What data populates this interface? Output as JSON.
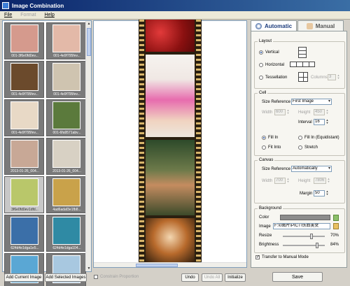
{
  "window": {
    "title": "Image Combination"
  },
  "menu": {
    "file": "File",
    "format": "Format",
    "help": "Help"
  },
  "thumbnails": [
    {
      "caption": "001-3f6e0fd0ev...",
      "color": "#d59a8d"
    },
    {
      "caption": "001-4e9f795fev...",
      "color": "#e3b9a8"
    },
    {
      "caption": "001-4e9f795fev...",
      "color": "#6b4a2c"
    },
    {
      "caption": "001-4e9f795fev...",
      "color": "#cfc4b0"
    },
    {
      "caption": "001-4e9f795fev...",
      "color": "#e8d9c6"
    },
    {
      "caption": "001-6fa9571abv...",
      "color": "#5b7a3c"
    },
    {
      "caption": "2013-01-26_004...",
      "color": "#c8a896"
    },
    {
      "caption": "2013-01-26_004...",
      "color": "#d8d1c4"
    },
    {
      "caption": "3f6e0fd0ev1dfd...",
      "color": "#b9c76a"
    },
    {
      "caption": "4ad6adaf3e1fb8...",
      "color": "#c9a24a"
    },
    {
      "caption": "624d4e1dga1e5...",
      "color": "#3b6fa8"
    },
    {
      "caption": "624d4e1dga104...",
      "color": "#2f8aa4"
    },
    {
      "caption": "",
      "color": "#5aa7d4"
    },
    {
      "caption": "",
      "color": "#a8c8e0"
    }
  ],
  "buttons": {
    "add_current": "Add Current Image",
    "add_selected": "Add Selected Images",
    "undo": "Undo",
    "undo_all": "Undo All",
    "initialize": "Initialize",
    "save": "Save"
  },
  "constrain_proportion": "Constrain Proportion",
  "tabs": {
    "automatic": "Automatic",
    "manual": "Manual"
  },
  "layout": {
    "legend": "Layout",
    "vertical": "Vertical",
    "horizontal": "Horizontal",
    "tessellation": "Tessellation",
    "columns_label": "Columns",
    "columns_value": "3"
  },
  "cell": {
    "legend": "Cell",
    "size_reference_label": "Size Reference",
    "size_reference_value": "First Image",
    "width_label": "Width",
    "width_value": "600",
    "height_label": "Height",
    "height_value": "450",
    "interval_label": "Interval",
    "interval_value": "16",
    "fill_in": "Fill In",
    "fill_in_equidistant": "Fill In (Equidistant)",
    "fit_into": "Fit Into",
    "stretch": "Stretch"
  },
  "canvas": {
    "legend": "Canvas",
    "size_reference_label": "Size Reference",
    "size_reference_value": "Automatically",
    "width_label": "Width",
    "width_value": "700",
    "height_label": "Height",
    "height_value": "7806",
    "margin_label": "Margin",
    "margin_value": "50"
  },
  "background": {
    "legend": "Background",
    "color_label": "Color",
    "color_value": "#8c8c8c",
    "image_label": "Image",
    "image_path": "F:\\0图片\\PICT\\铁血美女",
    "resize_label": "Resize",
    "resize_value": "70%",
    "resize_level": 0.7,
    "brightness_label": "Brightness",
    "brightness_value": "84%",
    "brightness_level": 0.84
  },
  "transfer_manual": "Transfer to Manual Mode",
  "colors": {
    "accent": "#1c3c7c",
    "titlebar": "#0a246a"
  }
}
